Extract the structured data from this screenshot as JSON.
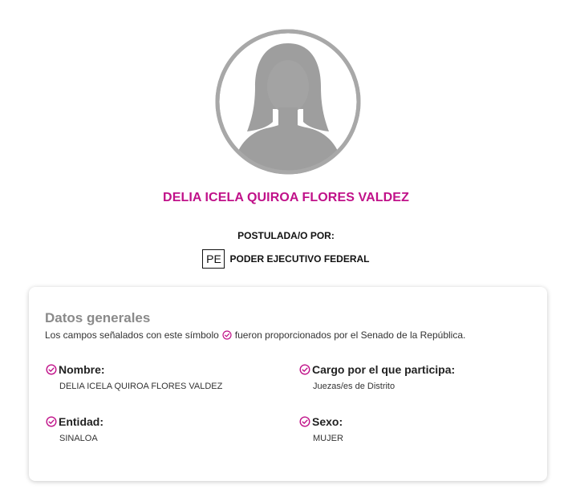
{
  "candidate": {
    "name": "DELIA ICELA QUIROA FLORES VALDEZ",
    "postulada_label": "POSTULADA/O POR:",
    "postulante_abbr": "PE",
    "postulante_name": "PODER EJECUTIVO FEDERAL",
    "avatar_icon": "female-silhouette-icon"
  },
  "general": {
    "title": "Datos generales",
    "desc_before": "Los campos señalados con este símbolo",
    "desc_after": "fueron proporcionados por el Senado de la República.",
    "fields": [
      {
        "label": "Nombre:",
        "value": "DELIA ICELA QUIROA FLORES VALDEZ"
      },
      {
        "label": "Cargo por el que participa:",
        "value": "Juezas/es de Distrito"
      },
      {
        "label": "Entidad:",
        "value": "SINALOA"
      },
      {
        "label": "Sexo:",
        "value": "MUJER"
      }
    ]
  },
  "colors": {
    "accent": "#c01189",
    "title_gray": "#8a8a8a",
    "avatar_gray": "#9e9e9e"
  }
}
